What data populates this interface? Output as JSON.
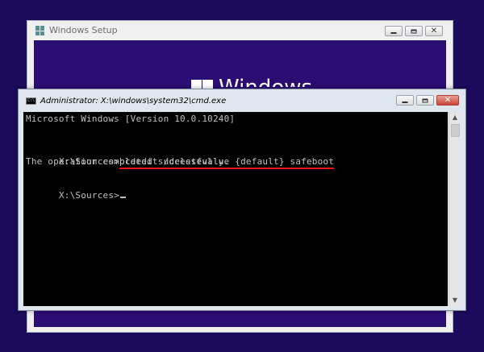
{
  "setup_window": {
    "title": "Windows Setup",
    "logo_text": "Windows"
  },
  "cmd_window": {
    "title": "Administrator: X:\\windows\\system32\\cmd.exe",
    "icon_label": "C:\\",
    "lines": {
      "version": "Microsoft Windows [Version 10.0.10240]",
      "prompt1": "X:\\Sources>",
      "command": "bcdedit /deletevalue {default} safeboot",
      "result": "The operation completed successfully.",
      "prompt2": "X:\\Sources>"
    }
  },
  "controls": {
    "close_glyph": "✕"
  },
  "colors": {
    "desktop_bg": "#1c0a5c",
    "setup_content_bg": "#2b0e74",
    "console_bg": "#000000",
    "console_text": "#c0c0c0",
    "highlight_underline": "#e8141a"
  }
}
